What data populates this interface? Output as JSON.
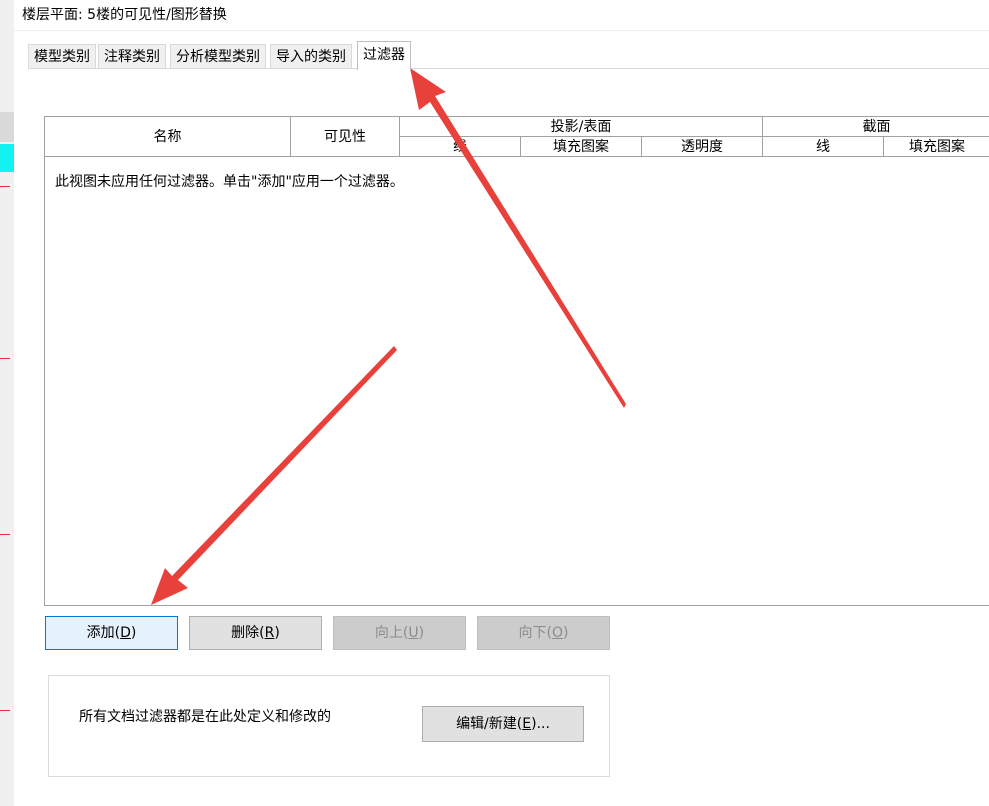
{
  "window": {
    "title": "楼层平面: 5楼的可见性/图形替换"
  },
  "tabs": [
    {
      "label": "模型类别",
      "active": false
    },
    {
      "label": "注释类别",
      "active": false
    },
    {
      "label": "分析模型类别",
      "active": false
    },
    {
      "label": "导入的类别",
      "active": false
    },
    {
      "label": "过滤器",
      "active": true
    }
  ],
  "table": {
    "headers": {
      "name": "名称",
      "visibility": "可见性",
      "projection_group": "投影/表面",
      "projection_cols": [
        "线",
        "填充图案",
        "透明度"
      ],
      "cut_group": "截面",
      "cut_cols": [
        "线",
        "填充图案"
      ]
    },
    "empty_message": "此视图未应用任何过滤器。单击\"添加\"应用一个过滤器。"
  },
  "buttons": {
    "add": {
      "text": "添加(",
      "key": "D",
      "close": ")"
    },
    "delete": {
      "text": "删除(",
      "key": "R",
      "close": ")"
    },
    "up": {
      "text": "向上(",
      "key": "U",
      "close": ")"
    },
    "down": {
      "text": "向下(",
      "key": "O",
      "close": ")"
    }
  },
  "filters_box": {
    "description": "所有文档过滤器都是在此处定义和修改的",
    "edit_button": {
      "text": "编辑/新建(",
      "key": "E",
      "close": ")..."
    }
  },
  "annotation_colors": {
    "arrow": "#e8413c"
  }
}
